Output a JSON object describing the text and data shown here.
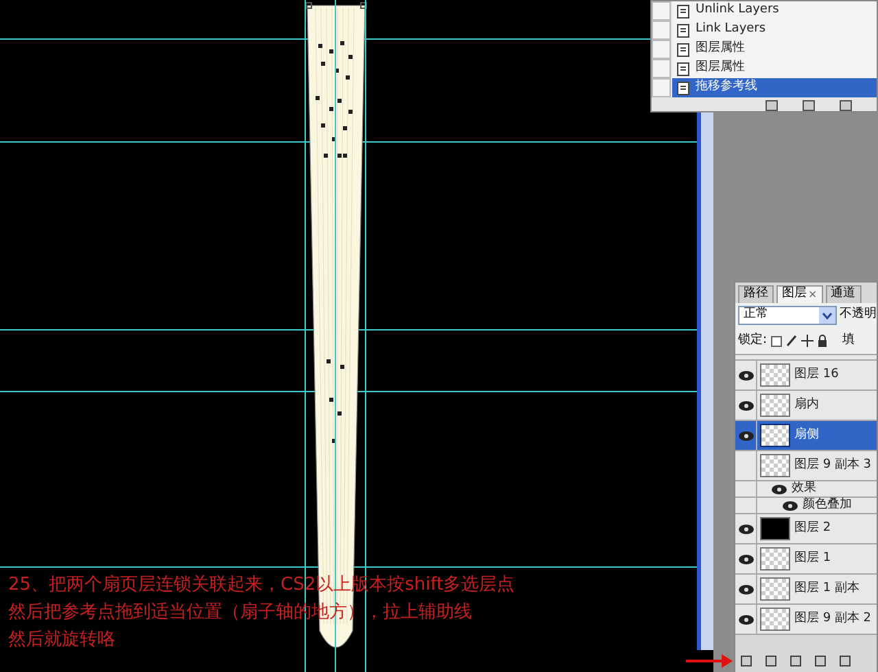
{
  "caption": {
    "lines": [
      "25、把两个扇页层连锁关联起来，CS2以上版本按shift多选层点",
      "然后把参考点拖到适当位置（扇子轴的地方），拉上辅助线",
      "然后就旋转咯"
    ]
  },
  "history_panel": {
    "items": [
      {
        "label": "Unlink Layers",
        "selected": false
      },
      {
        "label": "Link Layers",
        "selected": false
      },
      {
        "label": "图层属性",
        "selected": false
      },
      {
        "label": "图层属性",
        "selected": false
      },
      {
        "label": "拖移参考线",
        "selected": true
      }
    ]
  },
  "layers_panel": {
    "tabs": [
      {
        "label": "路径",
        "selected": false
      },
      {
        "label": "图层",
        "selected": true,
        "close": "×"
      },
      {
        "label": "通道",
        "selected": false
      }
    ],
    "blend_mode": "正常",
    "opacity_label": "不透明",
    "lock_label": "锁定:",
    "fill_label": "填",
    "layers": [
      {
        "name": "图层 16",
        "kind": "layer",
        "visible": true,
        "selected": false
      },
      {
        "name": "扇内",
        "kind": "layer",
        "visible": true,
        "selected": false
      },
      {
        "name": "扇侧",
        "kind": "layer",
        "visible": true,
        "selected": true
      },
      {
        "name": "图层 9 副本 3",
        "kind": "layer",
        "visible": false,
        "selected": false,
        "children": [
          {
            "name": "效果",
            "kind": "effect",
            "visible": true,
            "selected": false,
            "children": [
              {
                "name": "颜色叠加",
                "kind": "effect",
                "visible": true,
                "selected": false
              }
            ]
          }
        ]
      },
      {
        "name": "图层 2",
        "kind": "fill",
        "visible": true,
        "selected": false
      },
      {
        "name": "图层 1",
        "kind": "layer",
        "visible": true,
        "selected": false
      },
      {
        "name": "图层 1 副本",
        "kind": "layer",
        "visible": true,
        "selected": false
      },
      {
        "name": "图层 9 副本 2",
        "kind": "layer",
        "visible": true,
        "selected": false
      }
    ]
  }
}
